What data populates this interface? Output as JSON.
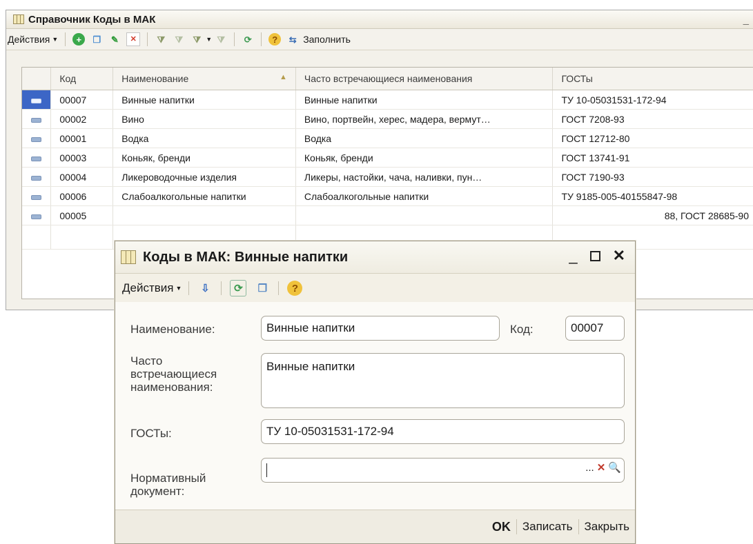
{
  "main_window": {
    "title": "Справочник Коды в МАК",
    "minimize": "_",
    "toolbar": {
      "actions_label": "Действия",
      "fill_label": "Заполнить"
    },
    "table": {
      "columns": [
        "Код",
        "Наименование",
        "Часто встречающиеся наименования",
        "ГОСТы"
      ],
      "rows": [
        {
          "code": "00007",
          "name": "Винные напитки",
          "common": "Винные напитки",
          "gost": "ТУ 10-05031531-172-94",
          "selected": true
        },
        {
          "code": "00002",
          "name": "Вино",
          "common": "Вино, портвейн, херес, мадера, вермут…",
          "gost": "ГОСТ 7208-93"
        },
        {
          "code": "00001",
          "name": "Водка",
          "common": "Водка",
          "gost": "ГОСТ 12712-80"
        },
        {
          "code": "00003",
          "name": "Коньяк, бренди",
          "common": "Коньяк, бренди",
          "gost": "ГОСТ 13741-91"
        },
        {
          "code": "00004",
          "name": "Ликероводочные изделия",
          "common": "Ликеры, настойки, чача, наливки, пун…",
          "gost": "ГОСТ 7190-93"
        },
        {
          "code": "00006",
          "name": "Слабоалкогольные напитки",
          "common": "Слабоалкогольные напитки",
          "gost": "ТУ 9185-005-40155847-98"
        },
        {
          "code": "00005",
          "name": "",
          "common": "",
          "gost": "88, ГОСТ 28685-90"
        }
      ]
    }
  },
  "dialog": {
    "title": "Коды в МАК: Винные напитки",
    "controls": {
      "minimize": "_",
      "close": "✕"
    },
    "toolbar": {
      "actions_label": "Действия"
    },
    "form": {
      "name_label": "Наименование:",
      "name_value": "Винные напитки",
      "code_label": "Код:",
      "code_value": "00007",
      "common_label_1": "Часто",
      "common_label_2": "встречающиеся",
      "common_label_3": "наименования:",
      "common_value": "Винные напитки",
      "gost_label": "ГОСТы:",
      "gost_value": "ТУ 10-05031531-172-94",
      "norm_label_1": "Нормативный",
      "norm_label_2": "документ:",
      "norm_value": "",
      "select_btn": "...",
      "clear_btn": "✕",
      "open_btn": "🔍"
    },
    "footer": {
      "ok": "OK",
      "write": "Записать",
      "close": "Закрыть"
    }
  }
}
